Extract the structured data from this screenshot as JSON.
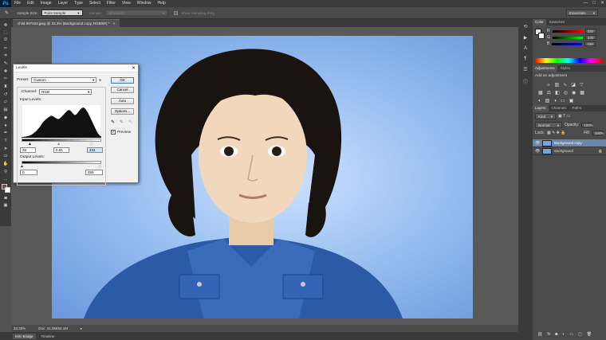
{
  "app": {
    "logo": "Ps"
  },
  "menu": [
    "File",
    "Edit",
    "Image",
    "Layer",
    "Type",
    "Select",
    "Filter",
    "View",
    "Window",
    "Help"
  ],
  "window_controls": {
    "minimize": "—",
    "maximize": "□",
    "close": "✕"
  },
  "options_bar": {
    "sample_size_label": "Sample Size:",
    "sample_size_value": "Point Sample",
    "sample_label": "Sample:",
    "sample_value": "All Layers",
    "show_ring_label": "Show Sampling Ring",
    "workspace": "Essentials"
  },
  "document_tab": {
    "title": "child-997533.jpeg @ 33.3% (Background copy, RGB/8#) *",
    "close": "×"
  },
  "status_bar": {
    "zoom": "33.33%",
    "doc": "Doc: 31.0M/62.1M"
  },
  "bottom_tabs": [
    "Mini Bridge",
    "Timeline"
  ],
  "color_panel": {
    "tabs": [
      "Color",
      "Swatches"
    ],
    "sliders": [
      {
        "label": "R",
        "value": "230"
      },
      {
        "label": "G",
        "value": "230"
      },
      {
        "label": "B",
        "value": "230"
      }
    ]
  },
  "adjustments_panel": {
    "tabs": [
      "Adjustments",
      "Styles"
    ],
    "heading": "Add an adjustment"
  },
  "layers_panel": {
    "tabs": [
      "Layers",
      "Channels",
      "Paths"
    ],
    "kind": "Kind",
    "blend": "Normal",
    "opacity_label": "Opacity:",
    "opacity": "100%",
    "lock_label": "Lock:",
    "fill_label": "Fill:",
    "fill": "100%",
    "layers": [
      {
        "name": "Background copy",
        "selected": true
      },
      {
        "name": "Background",
        "selected": false
      }
    ]
  },
  "levels_dialog": {
    "title": "Levels",
    "preset_label": "Preset:",
    "preset_value": "Custom",
    "channel_label": "Channel:",
    "channel_value": "RGB",
    "input_levels_label": "Input Levels:",
    "input_black": "28",
    "input_gray": "0.61",
    "input_white": "231",
    "output_levels_label": "Output Levels:",
    "output_black": "0",
    "output_white": "255",
    "buttons": [
      "OK",
      "Cancel",
      "Auto",
      "Options..."
    ],
    "preview_label": "Preview",
    "preview_checked": true,
    "histogram": [
      2,
      2,
      3,
      3,
      4,
      5,
      6,
      7,
      9,
      11,
      14,
      17,
      20,
      24,
      28,
      33,
      38,
      44,
      49,
      53,
      57,
      60,
      63,
      66,
      68,
      70,
      69,
      67,
      64,
      62,
      60,
      59,
      61,
      64,
      68,
      72,
      76,
      80,
      84,
      87,
      88,
      86,
      82,
      78,
      74,
      72,
      74,
      78,
      83,
      88,
      92,
      95,
      96,
      94,
      90,
      84,
      78,
      70,
      62,
      54,
      46,
      38,
      30,
      22,
      15,
      10,
      6,
      3
    ]
  }
}
